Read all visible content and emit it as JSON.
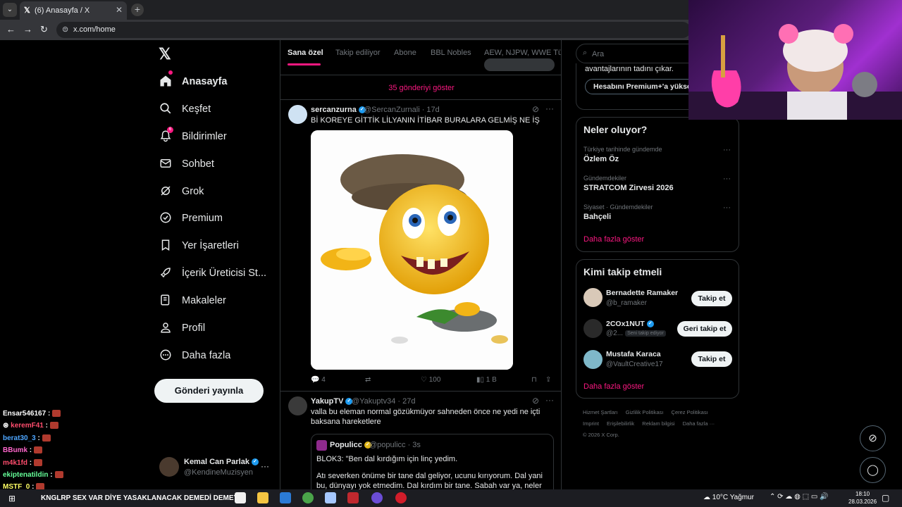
{
  "browser": {
    "tab_title": "(6) Anasayfa / X",
    "tab_favicon": "𝕏",
    "tab_close": "✕",
    "new_tab": "+",
    "url": "x.com/home",
    "back": "←",
    "forward": "→",
    "reload": "↻"
  },
  "sidebar": {
    "logo": "𝕏",
    "items": [
      {
        "label": "Anasayfa",
        "icon": "home-icon"
      },
      {
        "label": "Keşfet",
        "icon": "search-icon"
      },
      {
        "label": "Bildirimler",
        "icon": "bell-icon",
        "badge": "6"
      },
      {
        "label": "Sohbet",
        "icon": "mail-icon"
      },
      {
        "label": "Grok",
        "icon": "grok-icon"
      },
      {
        "label": "Premium",
        "icon": "verified-icon"
      },
      {
        "label": "Yer İşaretleri",
        "icon": "bookmark-icon"
      },
      {
        "label": "İçerik Üreticisi St...",
        "icon": "rocket-icon"
      },
      {
        "label": "Makaleler",
        "icon": "article-icon"
      },
      {
        "label": "Profil",
        "icon": "person-icon"
      },
      {
        "label": "Daha fazla",
        "icon": "more-circle-icon"
      }
    ],
    "post_button": "Gönderi yayınla",
    "account": {
      "name": "Kemal Can Parlak",
      "handle": "@KendineMuzisyen",
      "more": "···"
    }
  },
  "feed": {
    "tabs": [
      "Sana özel",
      "Takip ediliyor",
      "Abone",
      "BBL Nobles",
      "AEW, NJPW, WWE Türki"
    ],
    "show_posts": "35 gönderiyi göster",
    "tweets": [
      {
        "name": "sercanzurna",
        "handle": "@SercanZurnali · 17d",
        "text": "Bİ KOREYE GİTTİK LİLYANIN İTİBAR BURALARA GELMİŞ NE İŞ",
        "replies": "4",
        "likes": "100",
        "views": "1 B"
      },
      {
        "name": "YakupTV",
        "handle": "@Yakuptv34 · 27d",
        "text": "valla bu eleman normal gözükmüyor sahneden önce ne yedi ne içti baksana hareketlere",
        "quote": {
          "name": "Populicc",
          "handle": "@populicc · 3s",
          "line1": "BLOK3: \"Ben dal kırdığım için linç yedim.",
          "line2": "Atı severken önüme bir tane dal geliyor, ucunu kırıyorum. Dal yani bu, dünyayı yok etmedim. Dal kırdım bir tane. Sabah var ya, neler oldu.\""
        }
      }
    ]
  },
  "right": {
    "search_placeholder": "Ara",
    "premium_text": "avantajlarının tadını çıkar.",
    "premium_button": "Hesabını Premium+'a yükselt",
    "trends_title": "Neler oluyor?",
    "trends": [
      {
        "context": "Türkiye tarihinde gündemde",
        "name": "Özlem Öz"
      },
      {
        "context": "Gündemdekiler",
        "name": "STRATCOM Zirvesi 2026"
      },
      {
        "context": "Siyaset · Gündemdekiler",
        "name": "Bahçeli"
      }
    ],
    "trends_more": "Daha fazla göster",
    "wtf_title": "Kimi takip etmeli",
    "who_to_follow": [
      {
        "name": "Bernadette Ramaker",
        "handle": "@b_ramaker",
        "button": "Takip et",
        "badge": ""
      },
      {
        "name": "2COx1NUT",
        "handle": "@2...",
        "button": "Geri takip et",
        "badge": "Seni takip ediyor"
      },
      {
        "name": "Mustafa Karaca",
        "handle": "@VaultCreative17",
        "button": "Takip et",
        "badge": ""
      }
    ],
    "wtf_more": "Daha fazla göster",
    "footer": [
      "Hizmet Şartları",
      "Gizlilik Politikası",
      "Çerez Politikası",
      "Imprint",
      "Erişilebilirlik",
      "Reklam bilgisi",
      "Daha fazla ···",
      "© 2026 X Corp."
    ]
  },
  "chat": [
    {
      "user": "Ensar546167",
      "color": "#ffffff"
    },
    {
      "user": "keremF41",
      "color": "#ff4d6d"
    },
    {
      "user": "berat30_3",
      "color": "#4da6ff"
    },
    {
      "user": "BBumk",
      "color": "#ff66cc"
    },
    {
      "user": "m4k1fd",
      "color": "#ff4d6d"
    },
    {
      "user": "ekiptenatildin",
      "color": "#66ff99"
    },
    {
      "user": "MSTF_0",
      "color": "#ffff66"
    }
  ],
  "taskbar": {
    "marquee": "KNGLRP SEX VAR DİYE YASAKLANACAK DEMEDİ DEMEYİN",
    "weather": "10°C  Yağmur",
    "time": "18:10",
    "date": "28.03.2026"
  }
}
